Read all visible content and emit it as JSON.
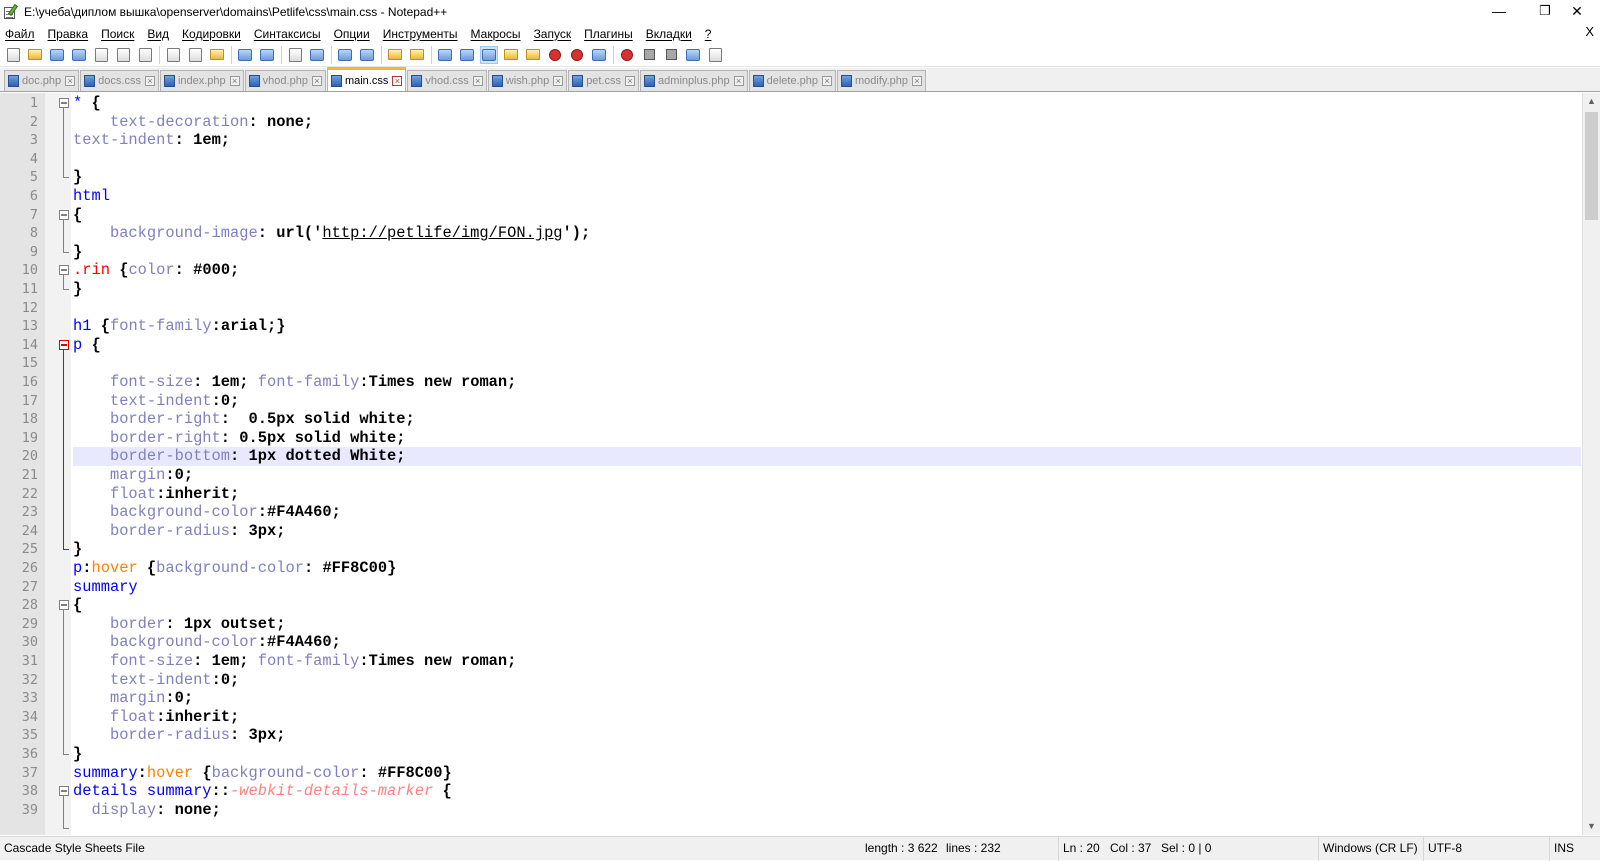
{
  "window": {
    "title": "E:\\учеба\\диплом вышка\\openserver\\domains\\Petlife\\css\\main.css - Notepad++",
    "minimize": "—",
    "restore": "❐",
    "close": "✕"
  },
  "menu": {
    "items": [
      "Файл",
      "Правка",
      "Поиск",
      "Вид",
      "Кодировки",
      "Синтаксисы",
      "Опции",
      "Инструменты",
      "Макросы",
      "Запуск",
      "Плагины",
      "Вкладки",
      "?"
    ],
    "close_doc": "X"
  },
  "toolbar": {
    "buttons": [
      {
        "icon": "new-file-icon",
        "style": "g"
      },
      {
        "icon": "open-file-icon",
        "style": "o"
      },
      {
        "icon": "save-icon",
        "style": "b"
      },
      {
        "icon": "save-all-icon",
        "style": "b"
      },
      {
        "icon": "close-icon",
        "style": "g"
      },
      {
        "icon": "close-all-icon",
        "style": "g"
      },
      {
        "icon": "print-icon",
        "style": "g"
      },
      {
        "sep": true
      },
      {
        "icon": "cut-icon",
        "style": "g"
      },
      {
        "icon": "copy-icon",
        "style": "g"
      },
      {
        "icon": "paste-icon",
        "style": "o"
      },
      {
        "sep": true
      },
      {
        "icon": "undo-icon",
        "style": "b"
      },
      {
        "icon": "redo-icon",
        "style": "b"
      },
      {
        "sep": true
      },
      {
        "icon": "find-icon",
        "style": "g"
      },
      {
        "icon": "replace-icon",
        "style": "b"
      },
      {
        "sep": true
      },
      {
        "icon": "zoom-in-icon",
        "style": "b"
      },
      {
        "icon": "zoom-out-icon",
        "style": "b"
      },
      {
        "sep": true
      },
      {
        "icon": "sync-vertical-icon",
        "style": "o"
      },
      {
        "icon": "sync-horizontal-icon",
        "style": "o"
      },
      {
        "sep": true
      },
      {
        "icon": "word-wrap-icon",
        "style": "b"
      },
      {
        "icon": "show-all-chars-icon",
        "style": "b"
      },
      {
        "icon": "indent-guide-icon",
        "style": "b",
        "active": true
      },
      {
        "icon": "user-language-icon",
        "style": "o"
      },
      {
        "icon": "document-map-icon",
        "style": "o"
      },
      {
        "icon": "function-list-icon",
        "style": "r"
      },
      {
        "icon": "folder-workspace-icon",
        "style": "r"
      },
      {
        "icon": "monitoring-icon",
        "style": "b"
      },
      {
        "sep": true
      },
      {
        "icon": "record-macro-icon",
        "style": "r"
      },
      {
        "icon": "stop-macro-icon",
        "style": "sq"
      },
      {
        "icon": "play-macro-icon",
        "style": "sq"
      },
      {
        "icon": "run-macro-multiple-icon",
        "style": "b"
      },
      {
        "icon": "save-macro-icon",
        "style": "g"
      }
    ]
  },
  "tabs": [
    {
      "label": "doc.php",
      "active": false
    },
    {
      "label": "docs.css",
      "active": false
    },
    {
      "label": "index.php",
      "active": false
    },
    {
      "label": "vhod.php",
      "active": false
    },
    {
      "label": "main.css",
      "active": true
    },
    {
      "label": "vhod.css",
      "active": false
    },
    {
      "label": "wish.php",
      "active": false
    },
    {
      "label": "pet.css",
      "active": false
    },
    {
      "label": "adminplus.php",
      "active": false
    },
    {
      "label": "delete.php",
      "active": false
    },
    {
      "label": "modify.php",
      "active": false
    }
  ],
  "editor": {
    "current_line": 20,
    "lines": [
      {
        "n": "1",
        "t": [
          [
            "sel",
            "* "
          ],
          [
            "pun",
            "{"
          ]
        ]
      },
      {
        "n": "2",
        "t": [
          [
            "sp",
            "    "
          ],
          [
            "prop",
            "text-decoration"
          ],
          [
            "pun",
            ": "
          ],
          [
            "val",
            "none;"
          ]
        ]
      },
      {
        "n": "3",
        "t": [
          [
            "prop",
            "text-indent"
          ],
          [
            "pun",
            ": "
          ],
          [
            "val",
            "1em;"
          ]
        ]
      },
      {
        "n": "4",
        "t": []
      },
      {
        "n": "5",
        "t": [
          [
            "pun",
            "}"
          ]
        ]
      },
      {
        "n": "6",
        "t": [
          [
            "sel",
            "html"
          ]
        ]
      },
      {
        "n": "7",
        "t": [
          [
            "pun",
            "{"
          ]
        ]
      },
      {
        "n": "8",
        "t": [
          [
            "sp",
            "    "
          ],
          [
            "prop",
            "background-image"
          ],
          [
            "pun",
            ": "
          ],
          [
            "val",
            "url('"
          ],
          [
            "url",
            "http://petlife/img/FON.jpg"
          ],
          [
            "val",
            "');"
          ]
        ]
      },
      {
        "n": "9",
        "t": [
          [
            "pun",
            "}"
          ]
        ]
      },
      {
        "n": "10",
        "t": [
          [
            "cls",
            ".rin "
          ],
          [
            "pun",
            "{"
          ],
          [
            "prop",
            "color"
          ],
          [
            "pun",
            ": "
          ],
          [
            "val",
            "#000;"
          ]
        ]
      },
      {
        "n": "11",
        "t": [
          [
            "pun",
            "}"
          ]
        ]
      },
      {
        "n": "12",
        "t": []
      },
      {
        "n": "13",
        "t": [
          [
            "sel",
            "h1 "
          ],
          [
            "pun",
            "{"
          ],
          [
            "prop",
            "font-family"
          ],
          [
            "pun",
            ":"
          ],
          [
            "val",
            "arial;"
          ],
          [
            "pun",
            "}"
          ]
        ]
      },
      {
        "n": "14",
        "t": [
          [
            "sel",
            "p "
          ],
          [
            "pun",
            "{"
          ]
        ]
      },
      {
        "n": "15",
        "t": []
      },
      {
        "n": "16",
        "t": [
          [
            "sp",
            "    "
          ],
          [
            "prop",
            "font-size"
          ],
          [
            "pun",
            ": "
          ],
          [
            "val",
            "1em; "
          ],
          [
            "prop",
            "font-family"
          ],
          [
            "pun",
            ":"
          ],
          [
            "val",
            "Times new roman;"
          ]
        ]
      },
      {
        "n": "17",
        "t": [
          [
            "sp",
            "    "
          ],
          [
            "prop",
            "text-indent"
          ],
          [
            "pun",
            ":"
          ],
          [
            "val",
            "0;"
          ]
        ]
      },
      {
        "n": "18",
        "t": [
          [
            "sp",
            "    "
          ],
          [
            "prop",
            "border-right"
          ],
          [
            "pun",
            ":  "
          ],
          [
            "val",
            "0.5px solid white;"
          ]
        ]
      },
      {
        "n": "19",
        "t": [
          [
            "sp",
            "    "
          ],
          [
            "prop",
            "border-right"
          ],
          [
            "pun",
            ": "
          ],
          [
            "val",
            "0.5px solid white;"
          ]
        ]
      },
      {
        "n": "20",
        "t": [
          [
            "sp",
            "    "
          ],
          [
            "prop",
            "border-bottom"
          ],
          [
            "pun",
            ": "
          ],
          [
            "val",
            "1px dotted White;"
          ]
        ]
      },
      {
        "n": "21",
        "t": [
          [
            "sp",
            "    "
          ],
          [
            "prop",
            "margin"
          ],
          [
            "pun",
            ":"
          ],
          [
            "val",
            "0;"
          ]
        ]
      },
      {
        "n": "22",
        "t": [
          [
            "sp",
            "    "
          ],
          [
            "prop",
            "float"
          ],
          [
            "pun",
            ":"
          ],
          [
            "val",
            "inherit;"
          ]
        ]
      },
      {
        "n": "23",
        "t": [
          [
            "sp",
            "    "
          ],
          [
            "prop",
            "background-color"
          ],
          [
            "pun",
            ":"
          ],
          [
            "val",
            "#F4A460;"
          ]
        ]
      },
      {
        "n": "24",
        "t": [
          [
            "sp",
            "    "
          ],
          [
            "prop",
            "border-radius"
          ],
          [
            "pun",
            ": "
          ],
          [
            "val",
            "3px;"
          ]
        ]
      },
      {
        "n": "25",
        "t": [
          [
            "pun",
            "}"
          ]
        ]
      },
      {
        "n": "26",
        "t": [
          [
            "sel",
            "p"
          ],
          [
            "pun",
            ":"
          ],
          [
            "pseudo",
            "hover "
          ],
          [
            "pun",
            "{"
          ],
          [
            "prop",
            "background-color"
          ],
          [
            "pun",
            ": "
          ],
          [
            "val",
            "#FF8C00"
          ],
          [
            "pun",
            "}"
          ]
        ]
      },
      {
        "n": "27",
        "t": [
          [
            "sel",
            "summary"
          ]
        ]
      },
      {
        "n": "28",
        "t": [
          [
            "pun",
            "{"
          ]
        ]
      },
      {
        "n": "29",
        "t": [
          [
            "sp",
            "    "
          ],
          [
            "prop",
            "border"
          ],
          [
            "pun",
            ": "
          ],
          [
            "val",
            "1px outset;"
          ]
        ]
      },
      {
        "n": "30",
        "t": [
          [
            "sp",
            "    "
          ],
          [
            "prop",
            "background-color"
          ],
          [
            "pun",
            ":"
          ],
          [
            "val",
            "#F4A460;"
          ]
        ]
      },
      {
        "n": "31",
        "t": [
          [
            "sp",
            "    "
          ],
          [
            "prop",
            "font-size"
          ],
          [
            "pun",
            ": "
          ],
          [
            "val",
            "1em; "
          ],
          [
            "prop",
            "font-family"
          ],
          [
            "pun",
            ":"
          ],
          [
            "val",
            "Times new roman;"
          ]
        ]
      },
      {
        "n": "32",
        "t": [
          [
            "sp",
            "    "
          ],
          [
            "prop",
            "text-indent"
          ],
          [
            "pun",
            ":"
          ],
          [
            "val",
            "0;"
          ]
        ]
      },
      {
        "n": "33",
        "t": [
          [
            "sp",
            "    "
          ],
          [
            "prop",
            "margin"
          ],
          [
            "pun",
            ":"
          ],
          [
            "val",
            "0;"
          ]
        ]
      },
      {
        "n": "34",
        "t": [
          [
            "sp",
            "    "
          ],
          [
            "prop",
            "float"
          ],
          [
            "pun",
            ":"
          ],
          [
            "val",
            "inherit;"
          ]
        ]
      },
      {
        "n": "35",
        "t": [
          [
            "sp",
            "    "
          ],
          [
            "prop",
            "border-radius"
          ],
          [
            "pun",
            ": "
          ],
          [
            "val",
            "3px;"
          ]
        ]
      },
      {
        "n": "36",
        "t": [
          [
            "pun",
            "}"
          ]
        ]
      },
      {
        "n": "37",
        "t": [
          [
            "sel",
            "summary"
          ],
          [
            "pun",
            ":"
          ],
          [
            "pseudo",
            "hover "
          ],
          [
            "pun",
            "{"
          ],
          [
            "prop",
            "background-color"
          ],
          [
            "pun",
            ": "
          ],
          [
            "val",
            "#FF8C00"
          ],
          [
            "pun",
            "}"
          ]
        ]
      },
      {
        "n": "38",
        "t": [
          [
            "sel",
            "details summary"
          ],
          [
            "pun",
            "::"
          ],
          [
            "wk",
            "-webkit-details-marker "
          ],
          [
            "pun",
            "{"
          ]
        ]
      },
      {
        "n": "39",
        "t": [
          [
            "sp",
            "  "
          ],
          [
            "prop",
            "display"
          ],
          [
            "pun",
            ": "
          ],
          [
            "val",
            "none;"
          ]
        ]
      }
    ],
    "folds": [
      {
        "start": 1,
        "end": 5,
        "red": false
      },
      {
        "start": 7,
        "end": 9,
        "red": false
      },
      {
        "start": 10,
        "end": 11,
        "red": false
      },
      {
        "start": 14,
        "end": 25,
        "red": true
      },
      {
        "start": 28,
        "end": 36,
        "red": false
      },
      {
        "start": 38,
        "end": 40,
        "red": false
      }
    ]
  },
  "scrollbar": {
    "up": "▲",
    "down": "▼"
  },
  "status": {
    "file_type": "Cascade Style Sheets File",
    "length": "length : 3 622",
    "lines": "lines : 232",
    "ln": "Ln : 20",
    "col": "Col : 37",
    "sel": "Sel : 0 | 0",
    "eol": "Windows (CR LF)",
    "encoding": "UTF-8",
    "mode": "INS"
  },
  "colors": {
    "selector": "#0000ff",
    "property": "#8080c0",
    "class": "#ff0000",
    "pseudo": "#ff8000",
    "webkit": "#ff8080",
    "current_line": "#e8e8ff",
    "active_tab_accent": "#fab13c"
  }
}
